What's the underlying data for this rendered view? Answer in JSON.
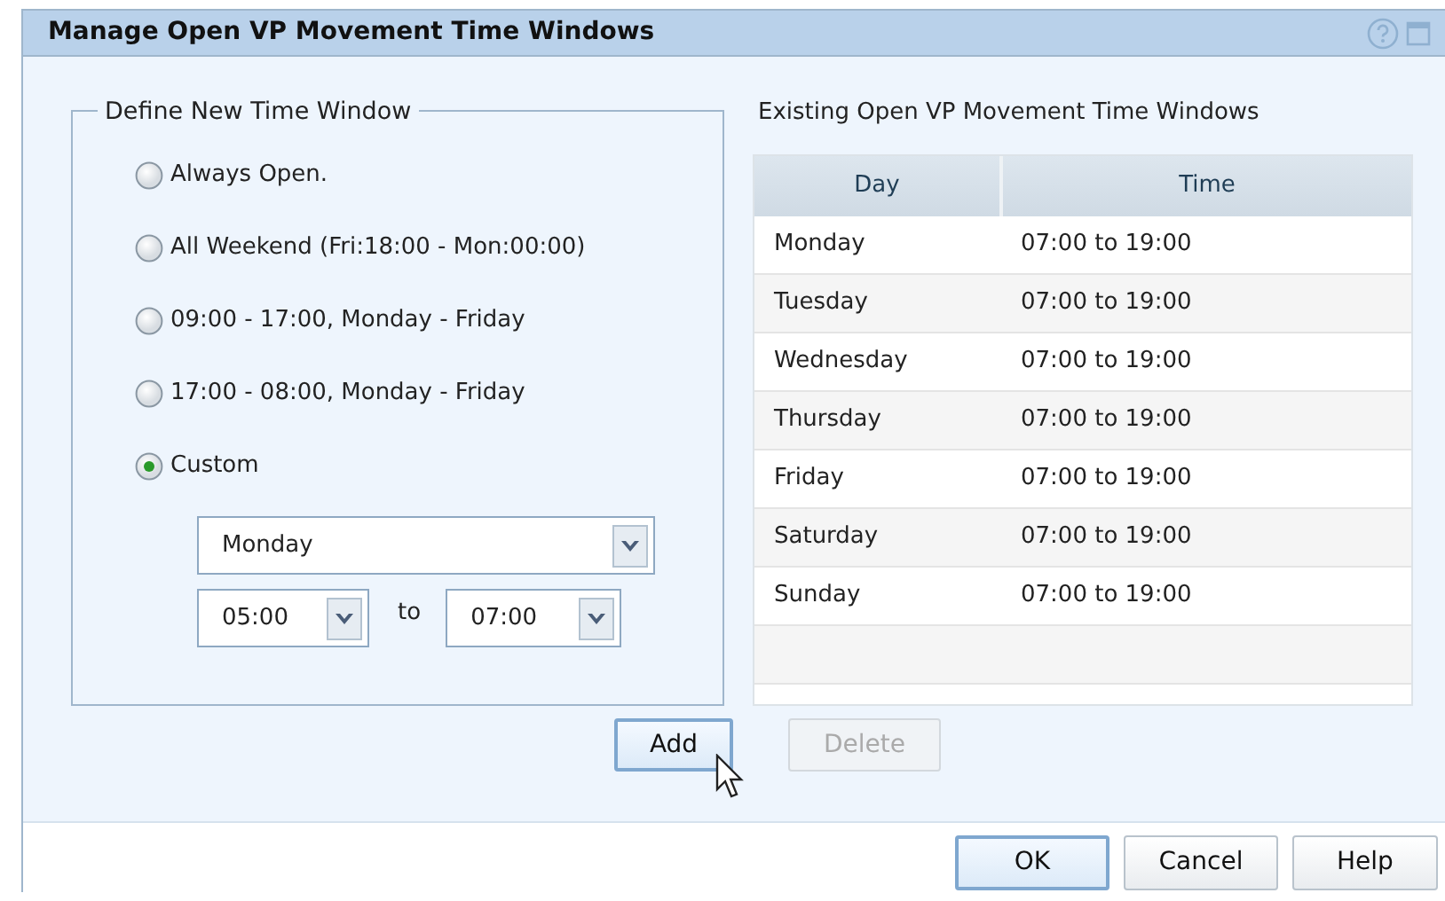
{
  "window": {
    "title": "Manage Open VP Movement Time Windows"
  },
  "define": {
    "legend": "Define New Time Window",
    "options": [
      {
        "label": "Always Open.",
        "selected": false
      },
      {
        "label": "All Weekend (Fri:18:00 - Mon:00:00)",
        "selected": false
      },
      {
        "label": "09:00 - 17:00, Monday - Friday",
        "selected": false
      },
      {
        "label": "17:00 - 08:00, Monday - Friday",
        "selected": false
      },
      {
        "label": "Custom",
        "selected": true
      }
    ],
    "day": "Monday",
    "from": "05:00",
    "to_label": "to",
    "to": "07:00"
  },
  "existing": {
    "title": "Existing Open VP Movement Time Windows",
    "columns": [
      "Day",
      "Time"
    ],
    "rows": [
      [
        "Monday",
        "07:00 to 19:00"
      ],
      [
        "Tuesday",
        "07:00 to 19:00"
      ],
      [
        "Wednesday",
        "07:00 to 19:00"
      ],
      [
        "Thursday",
        "07:00 to 19:00"
      ],
      [
        "Friday",
        "07:00 to 19:00"
      ],
      [
        "Saturday",
        "07:00 to 19:00"
      ],
      [
        "Sunday",
        "07:00 to 19:00"
      ]
    ]
  },
  "actions": [
    {
      "label": "Add",
      "disabled": false,
      "highlighted": true
    },
    {
      "label": "Delete",
      "disabled": true,
      "highlighted": false
    }
  ],
  "footer": [
    {
      "label": "OK",
      "highlighted": true
    },
    {
      "label": "Cancel",
      "highlighted": false
    },
    {
      "label": "Help",
      "highlighted": false
    }
  ]
}
